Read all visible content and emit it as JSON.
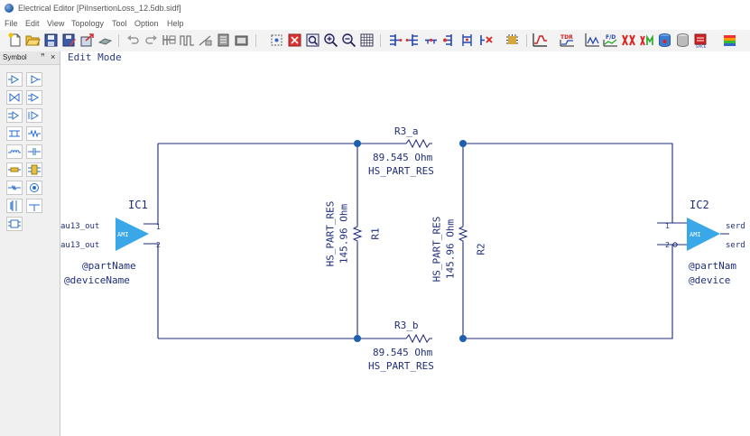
{
  "window": {
    "title": "Electrical Editor [PiInsertionLoss_12.5db.sidf]"
  },
  "menu": [
    "File",
    "Edit",
    "View",
    "Topology",
    "Tool",
    "Option",
    "Help"
  ],
  "toolbar": {
    "groups": [
      [
        "new-file-icon",
        "open-folder-icon",
        "save-icon",
        "save-as-icon",
        "export-icon",
        "link-icon"
      ],
      [
        "undo-icon",
        "redo-icon",
        "bus-icon",
        "pulse-icon",
        "measure-icon",
        "copy-icon",
        "paste-icon"
      ],
      [
        "select-area-icon",
        "fit-window-icon",
        "zoom-fit-icon",
        "zoom-in-icon",
        "zoom-out-icon",
        "grid-icon"
      ],
      [
        "add-port-icon",
        "add-port-2-icon",
        "net-icon",
        "add-pin-icon",
        "netlist-icon",
        "delete-net-icon",
        "component-icon"
      ],
      [
        "waveform-icon",
        "tdr-icon",
        "eye-icon",
        "frequency-icon",
        "crosstalk-icon",
        "jitter-icon",
        "database-icon",
        "cylinder-icon",
        "simulate-icon",
        "layers-icon"
      ]
    ]
  },
  "palette": {
    "title": "Symbol",
    "pin_label": "ꟸ",
    "close_label": "×",
    "items": [
      "driver-symbol-icon",
      "receiver-symbol-icon",
      "diff-driver-icon",
      "diff-receiver-icon",
      "io-buffer-icon",
      "terminator-icon",
      "tline-icon",
      "resistor-symbol-icon",
      "inductor-symbol-icon",
      "capacitor-symbol-icon",
      "fuse-icon",
      "connector-icon",
      "small-resistor-icon",
      "probe-icon",
      "transformer-icon",
      "ground-icon",
      "package-icon"
    ]
  },
  "editor": {
    "mode": "Edit Mode"
  },
  "schematic": {
    "ic1": {
      "ref": "IC1",
      "pin1_net": "au13_out",
      "pin2_net": "au13_out",
      "pin1": "1",
      "pin2": "2",
      "body": "AMI",
      "part": "@partName",
      "device": "@deviceName"
    },
    "ic2": {
      "ref": "IC2",
      "pin1_net": "serd",
      "pin2_net": "serd",
      "pin1": "1",
      "pin2": "2",
      "body": "AMI",
      "part": "@partNam",
      "device": "@device"
    },
    "r3a": {
      "ref": "R3_a",
      "value": "89.545 Ohm",
      "part": "HS_PART_RES"
    },
    "r3b": {
      "ref": "R3_b",
      "value": "89.545 Ohm",
      "part": "HS_PART_RES"
    },
    "r1": {
      "ref": "R1",
      "value": "145.96 Ohm",
      "part": "HS_PART_RES"
    },
    "r2": {
      "ref": "R2",
      "value": "145.96 Ohm",
      "part": "HS_PART_RES"
    }
  },
  "colors": {
    "wire": "#1c2a78",
    "node": "#1f5fb0",
    "amp": "#3aa7e8",
    "text": "#1f2f7a"
  }
}
